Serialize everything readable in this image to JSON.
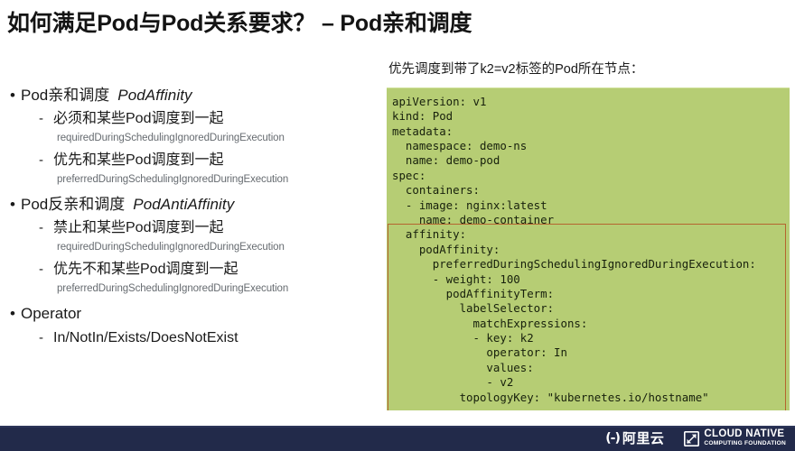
{
  "slide": {
    "title": "如何满足Pod与Pod关系要求？ – Pod亲和调度"
  },
  "bullets": {
    "groups": [
      {
        "heading": "Pod亲和调度",
        "heading_em": "PodAffinity",
        "items": [
          {
            "label": "必须和某些Pod调度到一起",
            "sub": "requiredDuringSchedulingIgnoredDuringExecution"
          },
          {
            "label": "优先和某些Pod调度到一起",
            "sub": "preferredDuringSchedulingIgnoredDuringExecution"
          }
        ]
      },
      {
        "heading": "Pod反亲和调度",
        "heading_em": "PodAntiAffinity",
        "items": [
          {
            "label": "禁止和某些Pod调度到一起",
            "sub": "requiredDuringSchedulingIgnoredDuringExecution"
          },
          {
            "label": "优先不和某些Pod调度到一起",
            "sub": "preferredDuringSchedulingIgnoredDuringExecution"
          }
        ]
      },
      {
        "heading": "Operator",
        "heading_em": "",
        "items": [
          {
            "label": "In/NotIn/Exists/DoesNotExist",
            "sub": ""
          }
        ]
      }
    ],
    "bullet_marker": "•",
    "dash_marker": "-"
  },
  "code": {
    "caption": "优先调度到带了k2=v2标签的Pod所在节点：",
    "background_color": "#b6cd74",
    "highlight_border_color": "#b5642f",
    "lines": [
      "apiVersion: v1",
      "kind: Pod",
      "metadata:",
      "  namespace: demo-ns",
      "  name: demo-pod",
      "spec:",
      "  containers:",
      "  - image: nginx:latest",
      "    name: demo-container",
      "  affinity:",
      "    podAffinity:",
      "      preferredDuringSchedulingIgnoredDuringExecution:",
      "      - weight: 100",
      "        podAffinityTerm:",
      "          labelSelector:",
      "            matchExpressions:",
      "            - key: k2",
      "              operator: In",
      "              values:",
      "              - v2",
      "          topologyKey: \"kubernetes.io/hostname\""
    ]
  },
  "footer": {
    "background_color": "#222a4a",
    "alibaba": {
      "mark": "(-)",
      "text": "阿里云"
    },
    "cncf": {
      "line1": "CLOUD NATIVE",
      "line2": "COMPUTING FOUNDATION"
    }
  }
}
